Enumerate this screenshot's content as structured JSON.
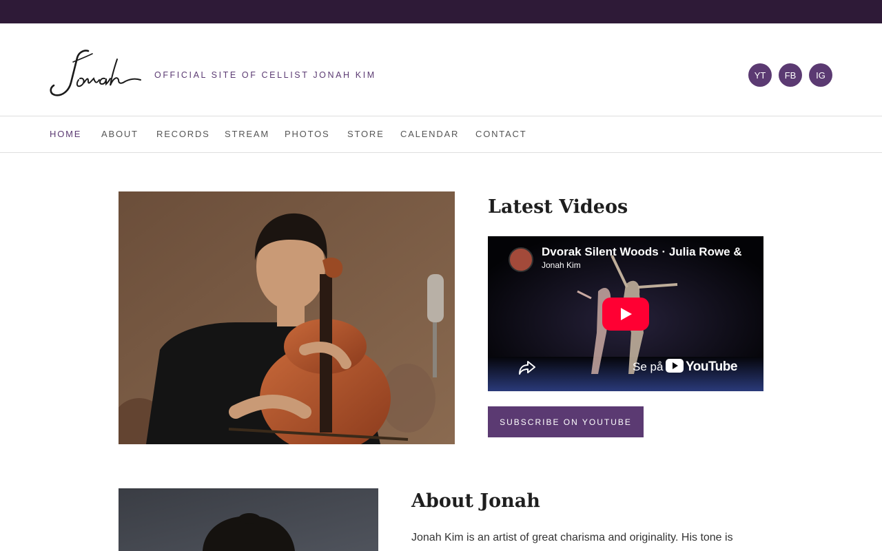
{
  "header": {
    "logo_text": "Jonah",
    "tagline": "OFFICIAL SITE OF CELLIST JONAH KIM",
    "social": [
      {
        "label": "YT",
        "icon": "youtube-icon"
      },
      {
        "label": "FB",
        "icon": "facebook-icon"
      },
      {
        "label": "IG",
        "icon": "instagram-icon"
      }
    ]
  },
  "nav": {
    "items": [
      "HOME",
      "ABOUT",
      "RECORDS",
      "STREAM",
      "PHOTOS",
      "STORE",
      "CALENDAR",
      "CONTACT"
    ],
    "active": "HOME"
  },
  "videos": {
    "title": "Latest Videos",
    "embed": {
      "title": "Dvorak Silent Woods · Julia Rowe &",
      "channel": "Jonah Kim",
      "watch_on": "Se på",
      "platform": "YouTube"
    },
    "subscribe_label": "SUBSCRIBE ON YOUTUBE"
  },
  "about": {
    "title": "About Jonah",
    "text": "Jonah Kim is an artist of great charisma and originality. His tone is"
  },
  "colors": {
    "topbar": "#2e1a37",
    "accent": "#5b3a72",
    "youtube_red": "#ff0033"
  }
}
